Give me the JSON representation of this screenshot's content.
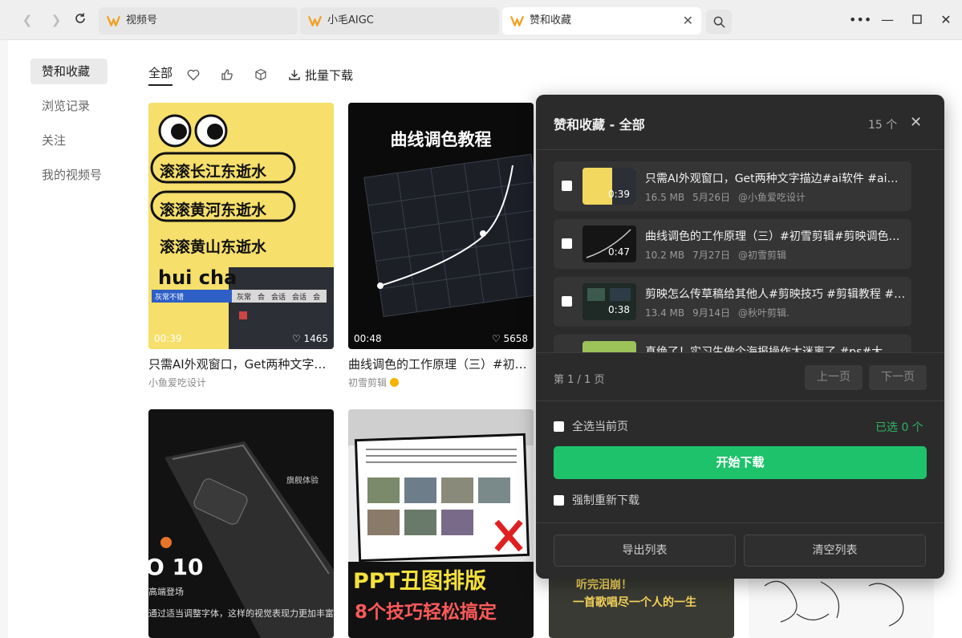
{
  "tabs": [
    {
      "label": "视频号"
    },
    {
      "label": "小毛AIGC"
    },
    {
      "label": "赞和收藏"
    }
  ],
  "sidebar": {
    "items": [
      {
        "label": "赞和收藏"
      },
      {
        "label": "浏览记录"
      },
      {
        "label": "关注"
      },
      {
        "label": "我的视频号"
      }
    ]
  },
  "filters": {
    "all_label": "全部",
    "batch_download_label": "批量下载"
  },
  "cards": [
    {
      "duration": "00:39",
      "likes": "1465",
      "title": "只需AI外观窗口，Get两种文字描边#ai软件 #ai教程",
      "author": "小鱼爱吃设计",
      "overlay_lines": [
        "滚滚长江东逝水",
        "滚滚黄河东逝水",
        "滚滚黄山东逝水",
        "hui cha"
      ],
      "ui_chips": [
        "灰常不错",
        "灰常",
        "合",
        "会话",
        "会话",
        "会"
      ]
    },
    {
      "duration": "00:48",
      "likes": "5658",
      "title": "曲线调色的工作原理（三）#初雪剪辑#剪映调色",
      "author": "初雪剪辑",
      "overlay_lines": [
        "曲线调色教程"
      ]
    },
    {
      "overlay_lines": [
        "旗舰体验",
        "O 10",
        "高端登场",
        "通过适当调整字体，这样的视觉表现力更加丰富"
      ]
    },
    {
      "overlay_lines": [
        "PPT丑图排版",
        "8个技巧轻松搞定"
      ]
    },
    {
      "overlay_lines": [
        "听完泪崩！",
        "一首歌唱尽一个人的一生"
      ]
    }
  ],
  "panel": {
    "title": "赞和收藏 - 全部",
    "count": "15 个",
    "items": [
      {
        "duration": "0:39",
        "title": "只需AI外观窗口，Get两种文字描边#ai软件 #ai教程",
        "size": "16.5 MB",
        "date": "5月26日",
        "author": "@小鱼爱吃设计"
      },
      {
        "duration": "0:47",
        "title": "曲线调色的工作原理（三）#初雪剪辑#剪映调色教程",
        "size": "10.2 MB",
        "date": "7月27日",
        "author": "@初雪剪辑"
      },
      {
        "duration": "0:38",
        "title": "剪映怎么传草稿给其他人#剪映技巧 #剪辑教程 #剪映",
        "size": "13.4 MB",
        "date": "9月14日",
        "author": "@秋叶剪辑."
      },
      {
        "title": "真绝了！实习生做个海报操作太迷离了 #ps#大"
      }
    ],
    "page_info": "第 1 / 1 页",
    "prev_label": "上一页",
    "next_label": "下一页",
    "select_all_label": "全选当前页",
    "selected_label": "已选 0 个",
    "start_label": "开始下载",
    "force_label": "强制重新下载",
    "export_label": "导出列表",
    "clear_label": "清空列表"
  },
  "colors": {
    "accent_green": "#1ec26a",
    "panel_bg": "#2b2b2b",
    "logo_orange": "#f0a020"
  }
}
